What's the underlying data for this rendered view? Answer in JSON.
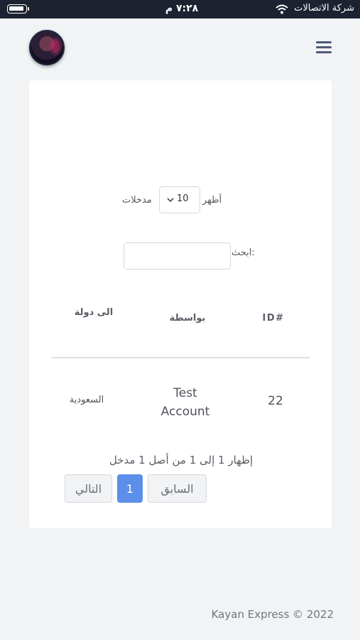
{
  "status_bar": {
    "carrier": "شركة الاتصالات",
    "time": "٧:٢٨ م"
  },
  "table_controls": {
    "show_label": "أظهر",
    "entries_label": "مدخلات",
    "page_length": "10",
    "search_label": "ابحث:",
    "search_value": "",
    "search_placeholder": ""
  },
  "table": {
    "columns": [
      "ID#",
      "بواسطة",
      "الى دولة"
    ],
    "rows": [
      {
        "id": "22",
        "by": "Test Account",
        "to_country": "السعودية"
      }
    ]
  },
  "pagination": {
    "info": "إظهار 1 إلى 1 من أصل 1 مدخل",
    "previous": "السابق",
    "current_page": "1",
    "next": "التالي"
  },
  "footer": {
    "copyright": "Kayan Express © 2022"
  },
  "colors": {
    "accent": "#5b8fe9",
    "status_bar": "#1c2230",
    "background": "#f1f3f4"
  }
}
